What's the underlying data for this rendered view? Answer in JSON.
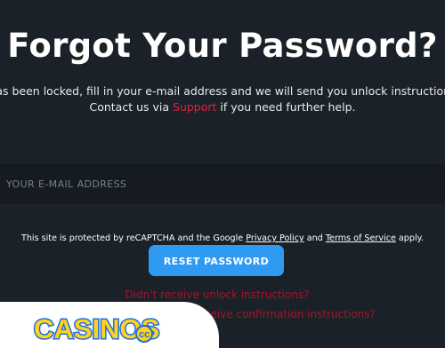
{
  "page": {
    "title": "Forgot Your Password?",
    "desc_line1": "has been locked, fill in your e-mail address and we will send you unlock instructions",
    "desc_line2_before": "Contact us via ",
    "desc_line2_link": "Support",
    "desc_line2_after": " if you need further help."
  },
  "form": {
    "email_placeholder": "YOUR E-MAIL ADDRESS",
    "email_value": "",
    "captcha_before": "This site is protected by reCAPTCHA and the Google ",
    "privacy_link": "Privacy Policy",
    "captcha_and": " and ",
    "terms_link": "Terms of Service",
    "captcha_after": " apply.",
    "reset_button": "RESET PASSWORD"
  },
  "links": {
    "unlock": "Didn't receive unlock instructions?",
    "confirmation": "Didn't receive confirmation instructions?"
  },
  "badge": {
    "brand_text": "CASINOS.cc",
    "logo_icon": "casinos-cc-logo"
  },
  "colors": {
    "background": "#1b2128",
    "accent_blue": "#2f9af2",
    "link_red": "#e0213c",
    "logo_blue": "#1f6fe0",
    "logo_yellow": "#ffd21f"
  }
}
